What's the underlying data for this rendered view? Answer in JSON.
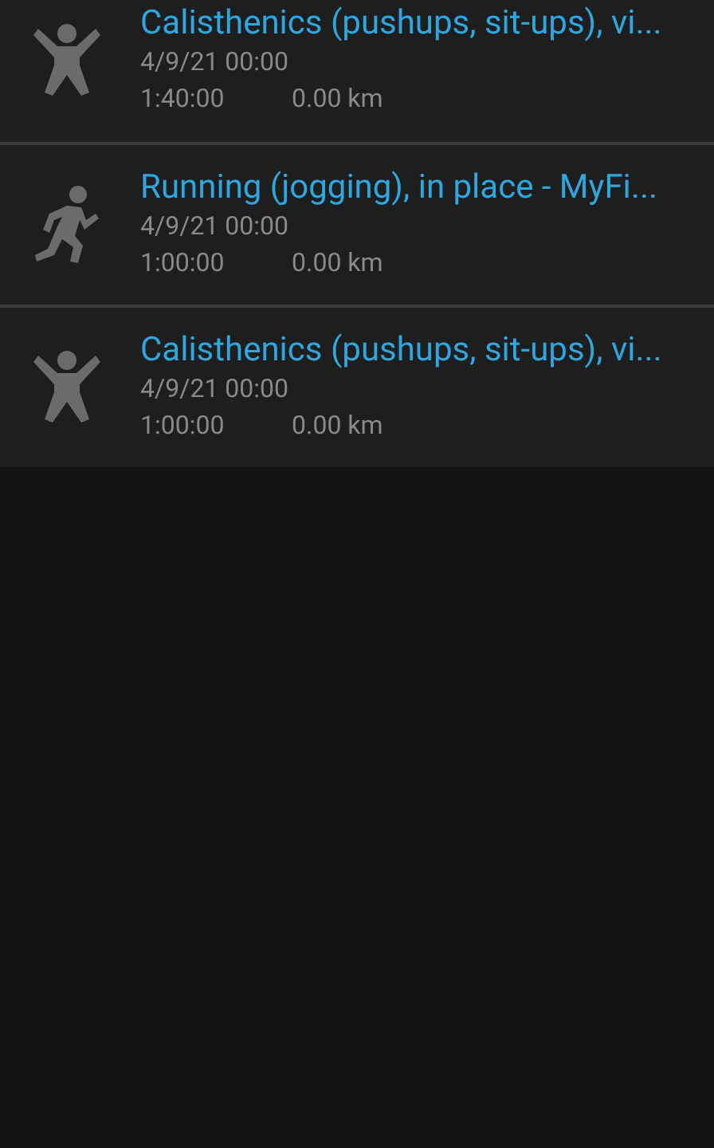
{
  "activities": [
    {
      "kind": "calisthenics",
      "title": "Calisthenics (pushups, sit-ups), vi...",
      "date": "4/9/21 00:00",
      "duration": "1:40:00",
      "distance": "0.00 km"
    },
    {
      "kind": "running",
      "title": "Running (jogging), in place - MyFi...",
      "date": "4/9/21 00:00",
      "duration": "1:00:00",
      "distance": "0.00 km"
    },
    {
      "kind": "calisthenics",
      "title": "Calisthenics (pushups, sit-ups), vi...",
      "date": "4/9/21 00:00",
      "duration": "1:00:00",
      "distance": "0.00 km"
    }
  ]
}
